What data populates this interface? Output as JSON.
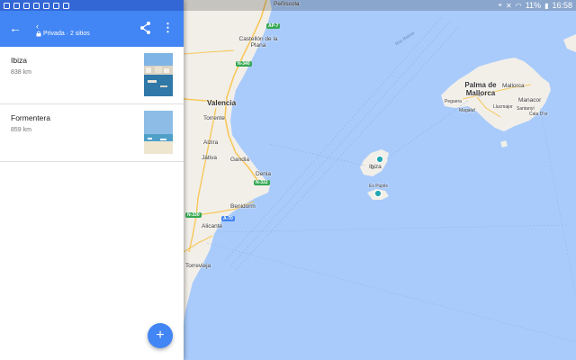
{
  "status_bar": {
    "battery": "11%",
    "time": "16:58",
    "icons": [
      "check-icon",
      "instagram-icon",
      "check-icon",
      "mail-icon",
      "instagram-icon",
      "twitter-icon",
      "mail-icon"
    ]
  },
  "panel": {
    "title": "‹",
    "meta": "Privada · 2 sitios",
    "places": [
      {
        "name": "Ibiza",
        "distance": "838 km"
      },
      {
        "name": "Formentera",
        "distance": "859 km"
      }
    ]
  },
  "map": {
    "labels": {
      "peniscola": "Peñíscola",
      "castellon": "Castellón de la Plana",
      "valencia": "Valencia",
      "torrente": "Torrente",
      "alzira": "Alzira",
      "xativa": "Játiva",
      "gandia": "Gandia",
      "denia": "Denia",
      "benidorm": "Benidorm",
      "alicante": "Alicante",
      "torrevieja": "Torrevieja",
      "ibiza": "Ibiza",
      "es_pujols": "Es Pujols",
      "palma": "Palma de Mallorca",
      "mallorca": "Mallorca",
      "manacor": "Manacor",
      "magaluf": "Magaluf",
      "llucmajor": "Llucmajor",
      "santanyi": "Santanyí",
      "cala_dor": "Cala D'or",
      "paguera": "Peguera",
      "mar_balear": "Mar Balear"
    },
    "colors": {
      "sea": "#a9cbfb",
      "land": "#f2efe9",
      "road": "#f7c85a",
      "accent": "#4285f4"
    }
  }
}
